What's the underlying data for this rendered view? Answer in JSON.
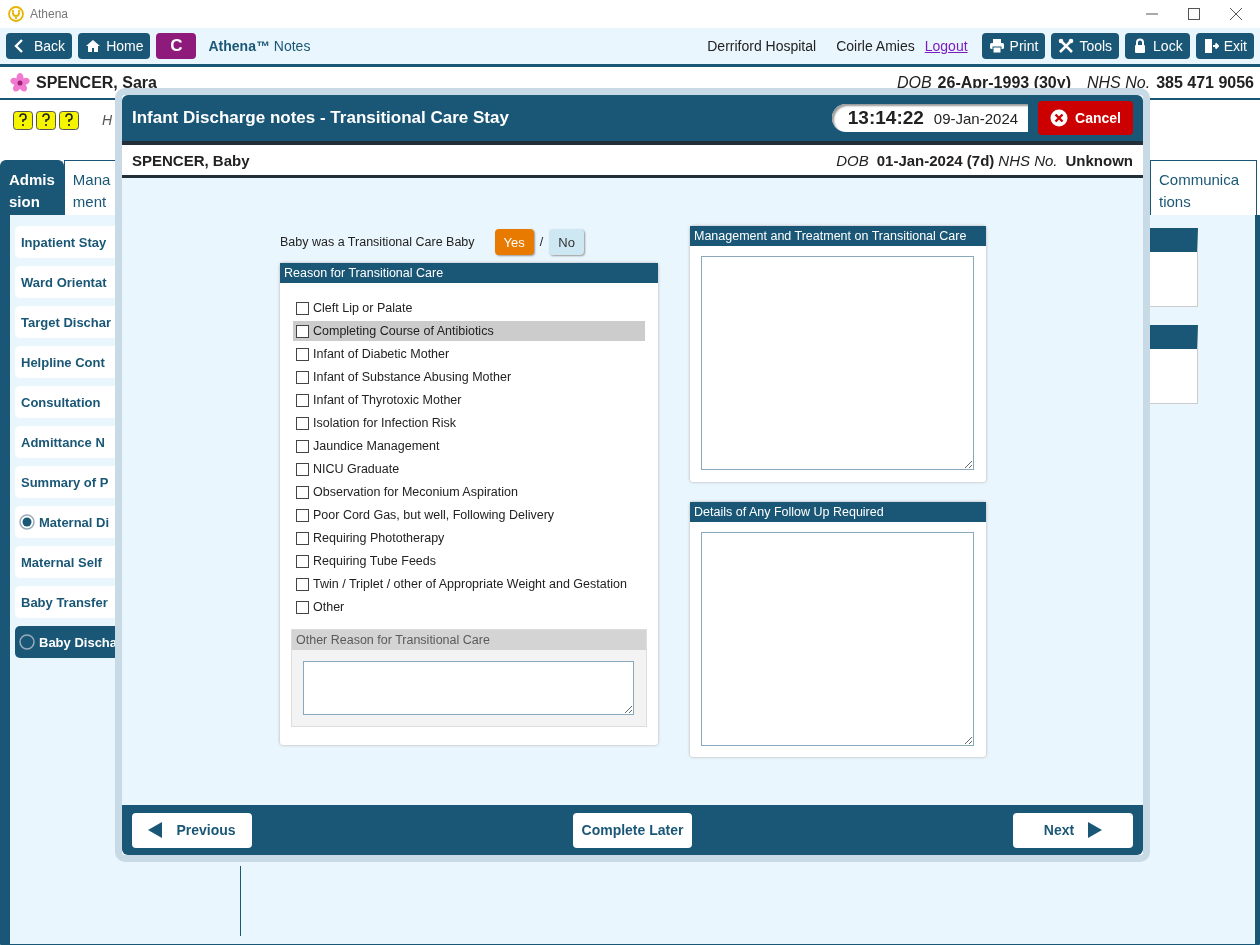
{
  "window": {
    "title": "Athena"
  },
  "toolbar": {
    "left_buttons": [
      {
        "label": "Back"
      },
      {
        "label": "Home"
      }
    ],
    "badge": "C",
    "app_name": "**Athena™** Notes",
    "hospital": "Derriford Hospital",
    "user": "Coirle Amies",
    "logout": "Logout",
    "right_buttons": [
      {
        "label": "Print"
      },
      {
        "label": "Tools"
      },
      {
        "label": "Lock"
      },
      {
        "label": "Exit"
      }
    ]
  },
  "patient": {
    "name": "SPENCER, Sara",
    "dob_label": "DOB",
    "dob": "26-Apr-1993 (30y)",
    "nhs_label": "NHS No.",
    "nhs": "385 471 9056"
  },
  "info_text": "H",
  "tabs": [
    {
      "lines": [
        "Admis",
        "sion"
      ],
      "selected": true
    },
    {
      "lines": [
        "Mana",
        "ment"
      ],
      "selected": false
    }
  ],
  "right_tab": {
    "lines": [
      "Communica",
      "tions"
    ],
    "selected": false
  },
  "sidebar": {
    "items": [
      {
        "label": "Inpatient Stay",
        "kind": "plain",
        "selected": false
      },
      {
        "label": "Ward Orientat",
        "kind": "plain",
        "selected": false
      },
      {
        "label": "Target Dischar",
        "kind": "plain",
        "selected": false
      },
      {
        "label": "Helpline Cont",
        "kind": "plain",
        "selected": false
      },
      {
        "label": "Consultation",
        "kind": "plain",
        "selected": false
      },
      {
        "label": "Admittance N",
        "kind": "plain",
        "selected": false
      },
      {
        "label": "Summary of P",
        "kind": "plain",
        "selected": false
      },
      {
        "label": "Maternal Di",
        "kind": "radio",
        "checked": true,
        "selected": false
      },
      {
        "label": "Maternal Self",
        "kind": "plain",
        "selected": false
      },
      {
        "label": "Baby Transfer",
        "kind": "plain",
        "selected": false
      },
      {
        "label": "Baby Discha",
        "kind": "radio",
        "checked": false,
        "selected": true
      }
    ]
  },
  "dialog": {
    "title": "Infant Discharge notes - Transitional Care Stay",
    "time": "13:14:22",
    "date": "09-Jan-2024",
    "cancel": "Cancel",
    "baby": {
      "name": "SPENCER, Baby",
      "dob_label": "DOB",
      "dob": "01-Jan-2024 (7d)",
      "nhs_label": "NHS No.",
      "nhs": "Unknown"
    },
    "question": {
      "label": "Baby was a Transitional Care Baby",
      "separator": "/",
      "options": [
        {
          "label": "Yes",
          "selected": true
        },
        {
          "label": "No",
          "selected": false
        }
      ]
    },
    "reasons": {
      "title": "Reason for Transitional Care",
      "items": [
        {
          "label": "Cleft Lip or Palate",
          "checked": false,
          "highlighted": false
        },
        {
          "label": "Completing Course of Antibiotics",
          "checked": false,
          "highlighted": true
        },
        {
          "label": "Infant of Diabetic Mother",
          "checked": false,
          "highlighted": false
        },
        {
          "label": "Infant of Substance Abusing Mother",
          "checked": false,
          "highlighted": false
        },
        {
          "label": "Infant of Thyrotoxic Mother",
          "checked": false,
          "highlighted": false
        },
        {
          "label": "Isolation for Infection Risk",
          "checked": false,
          "highlighted": false
        },
        {
          "label": "Jaundice Management",
          "checked": false,
          "highlighted": false
        },
        {
          "label": "NICU Graduate",
          "checked": false,
          "highlighted": false
        },
        {
          "label": "Observation for Meconium Aspiration",
          "checked": false,
          "highlighted": false
        },
        {
          "label": "Poor Cord Gas, but well, Following Delivery",
          "checked": false,
          "highlighted": false
        },
        {
          "label": "Requiring Phototherapy",
          "checked": false,
          "highlighted": false
        },
        {
          "label": "Requiring Tube Feeds",
          "checked": false,
          "highlighted": false
        },
        {
          "label": "Twin / Triplet / other of Appropriate Weight and Gestation",
          "checked": false,
          "highlighted": false
        },
        {
          "label": "Other",
          "checked": false,
          "highlighted": false
        }
      ]
    },
    "other_reason": {
      "title": "Other Reason for Transitional Care",
      "disabled": true
    },
    "management": {
      "title": "Management and Treatment on Transitional Care"
    },
    "follow_up": {
      "title": "Details of Any Follow Up Required"
    },
    "footer": {
      "previous": "Previous",
      "complete_later": "Complete Later",
      "next": "Next"
    }
  }
}
